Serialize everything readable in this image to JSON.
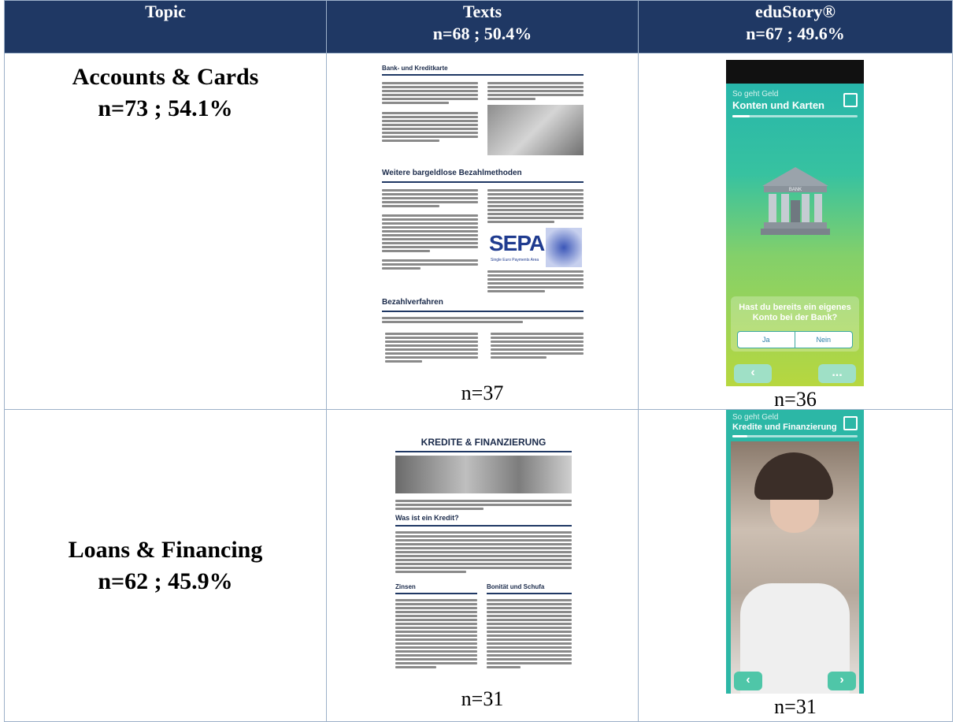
{
  "header": {
    "topic": "Topic",
    "texts_line1": "Texts",
    "texts_line2": "n=68 ; 50.4%",
    "edustory_line1": "eduStory®",
    "edustory_line2": "n=67 ; 49.6%"
  },
  "rows": [
    {
      "topic_line1": "Accounts & Cards",
      "topic_line2": "n=73 ; 54.1%",
      "texts_n": "n=37",
      "edustory_n": "n=36",
      "doc": {
        "heading1": "Bank- und Kreditkarte",
        "heading2": "Weitere bargeldlose Bezahlmethoden",
        "heading3": "Bezahlverfahren",
        "logo": "SEPA",
        "logo_sub": "Single Euro Payments Area"
      },
      "app": {
        "subtitle": "So geht Geld",
        "title": "Konten und Karten",
        "bank_sign": "BANK",
        "question": "Hast du bereits ein eigenes Konto bei der Bank?",
        "answer_yes": "Ja",
        "answer_no": "Nein",
        "back": "‹",
        "more": "..."
      }
    },
    {
      "topic_line1": "Loans & Financing",
      "topic_line2": "n=62 ; 45.9%",
      "texts_n": "n=31",
      "edustory_n": "n=31",
      "doc": {
        "heading1": "KREDITE & FINANZIERUNG",
        "heading2": "Was ist ein Kredit?",
        "heading3a": "Zinsen",
        "heading3b": "Bonität und Schufa"
      },
      "app": {
        "subtitle": "So geht Geld",
        "title": "Kredite und Finanzierung",
        "back": "‹",
        "next": "›"
      }
    }
  ],
  "colors": {
    "header_bg": "#1f3864",
    "border": "#9db1c9",
    "app_teal": "#2cb7a6",
    "app_green": "#b5d73c"
  }
}
